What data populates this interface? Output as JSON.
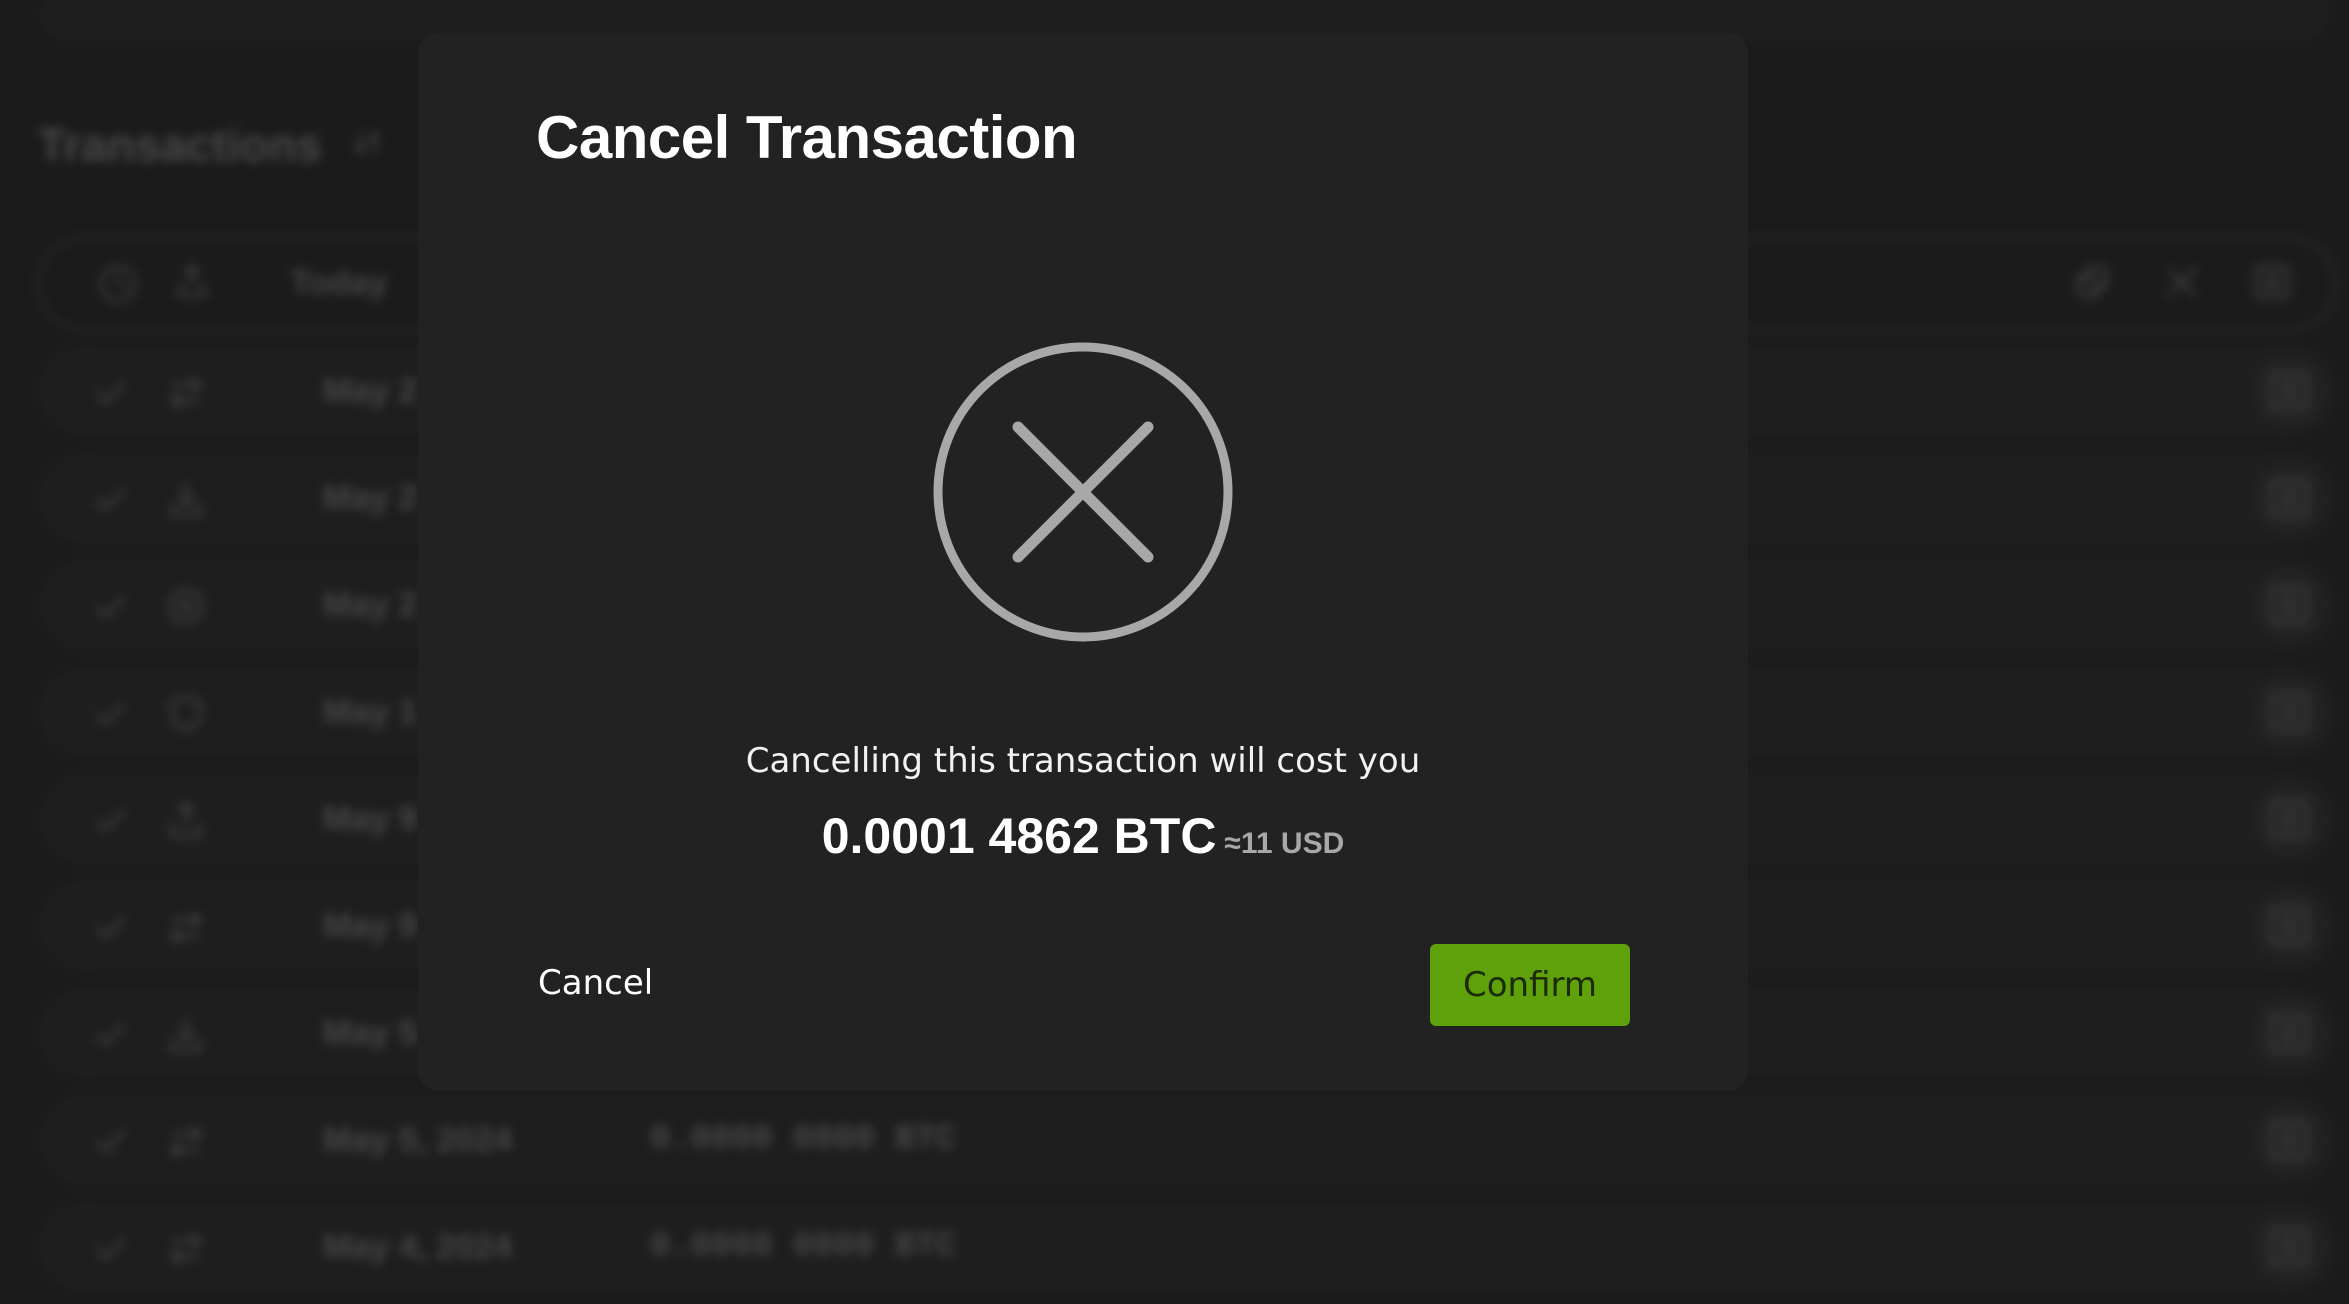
{
  "background": {
    "section_title": "Transactions",
    "filter_bar_date": "Today",
    "rows": [
      {
        "date": "May 2",
        "amount": "",
        "type_icon": "swap-icon"
      },
      {
        "date": "May 2",
        "amount": "",
        "type_icon": "receive-icon"
      },
      {
        "date": "May 2",
        "amount": "",
        "type_icon": "cancel-circle-icon"
      },
      {
        "date": "May 1",
        "amount": "",
        "type_icon": "shield-icon"
      },
      {
        "date": "May 9",
        "amount": "",
        "type_icon": "send-icon"
      },
      {
        "date": "May 9",
        "amount": "",
        "type_icon": "swap-icon"
      },
      {
        "date": "May 5",
        "amount": "",
        "type_icon": "receive-icon"
      },
      {
        "date": "May 5, 2024",
        "amount": "0.0000 0000 BTC",
        "type_icon": "swap-icon"
      },
      {
        "date": "May 4, 2024",
        "amount": "0.0000 0000 BTC",
        "type_icon": "swap-icon"
      }
    ]
  },
  "dialog": {
    "title": "Cancel Transaction",
    "icon": "cancel-circle-icon",
    "message": "Cancelling this transaction will cost you",
    "amount": "0.0001 4862 BTC",
    "fiat_equivalent": "≈11 USD",
    "cancel_label": "Cancel",
    "confirm_label": "Confirm"
  },
  "colors": {
    "dialog_bg": "#222222",
    "confirm_bg": "#5ea10a",
    "icon_gray": "#a8a8a8"
  }
}
